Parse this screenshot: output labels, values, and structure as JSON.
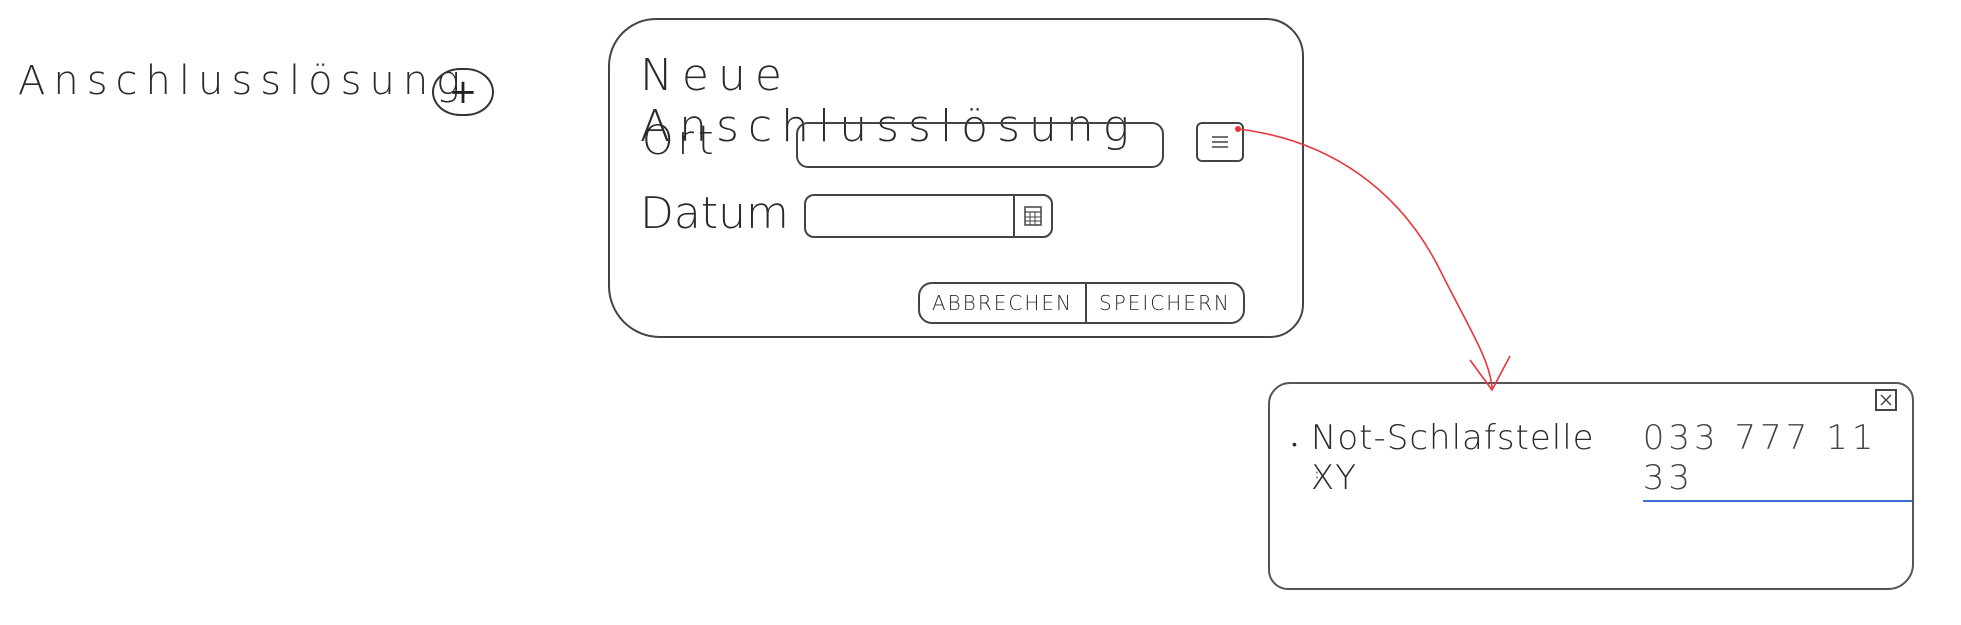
{
  "heading": {
    "text": "Anschlusslösung",
    "add_symbol": "+"
  },
  "dialog": {
    "title": "Neue Anschlusslösung",
    "ort_label": "Ort",
    "datum_label": "Datum",
    "cancel_label": "Abbrechen",
    "save_label": "Speichern"
  },
  "popup": {
    "items": [
      {
        "name": "Not-Schlafstelle XY",
        "phone": "033 777 11 33"
      }
    ],
    "more": "⋮"
  },
  "colors": {
    "connector": "#e8343a",
    "link": "#3a6fd8"
  }
}
